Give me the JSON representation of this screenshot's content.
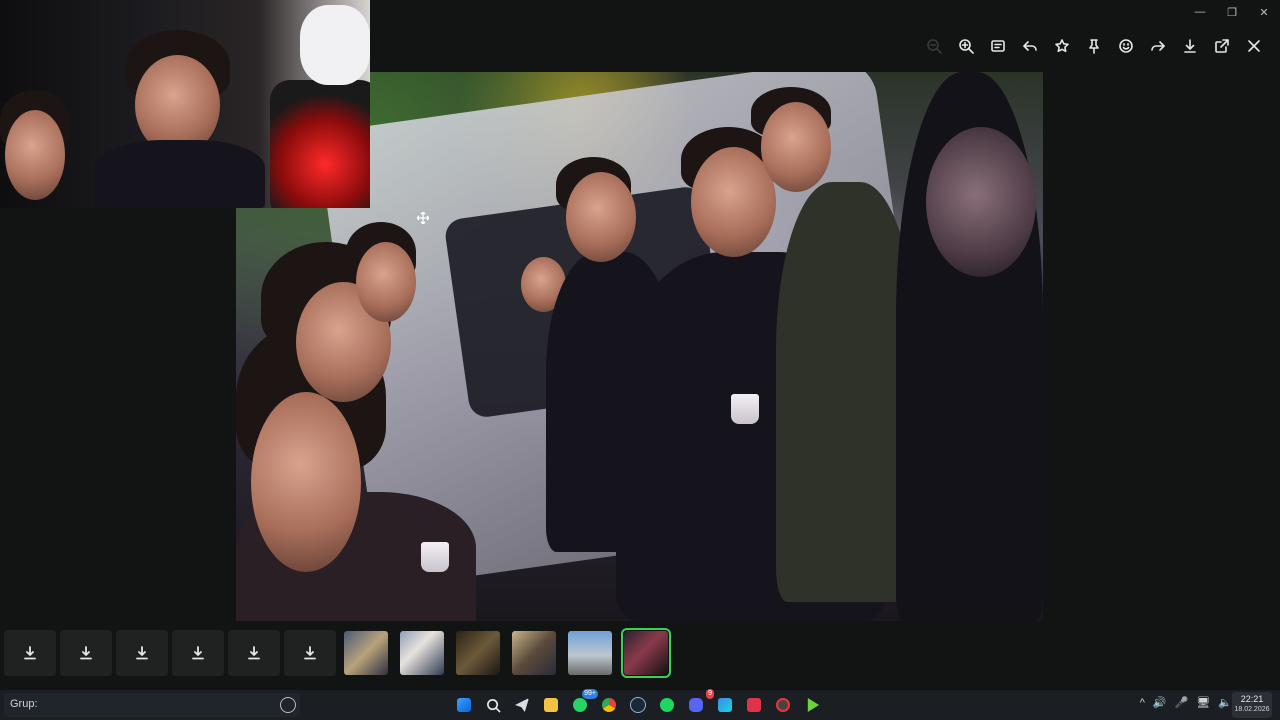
{
  "window": {
    "controls": {
      "minimize": "—",
      "restore": "❐",
      "close": "✕"
    }
  },
  "viewer_toolbar": {
    "icons": [
      "zoom-out-icon",
      "zoom-in-icon",
      "caption-icon",
      "reply-icon",
      "star-icon",
      "pin-icon",
      "emoji-icon",
      "forward-icon",
      "download-icon",
      "open-external-icon",
      "close-icon"
    ]
  },
  "main_photo": {
    "description_icon": "group-selfie-photo"
  },
  "thumbnail_strip": {
    "download_tiles": 6,
    "photo_thumbnails": 6,
    "active_index": 5
  },
  "taskbar": {
    "search_text": "Grup:",
    "badges": {
      "whatsapp": "99+",
      "discord": "9"
    },
    "tray_icons": [
      "^",
      "🔊",
      "🎤",
      "🖥",
      "🔈"
    ],
    "time": "22:21",
    "date": "18.02.2026"
  },
  "colors": {
    "background": "#111413",
    "accent_green": "#3ad15b",
    "taskbar": "#1b1f24"
  }
}
